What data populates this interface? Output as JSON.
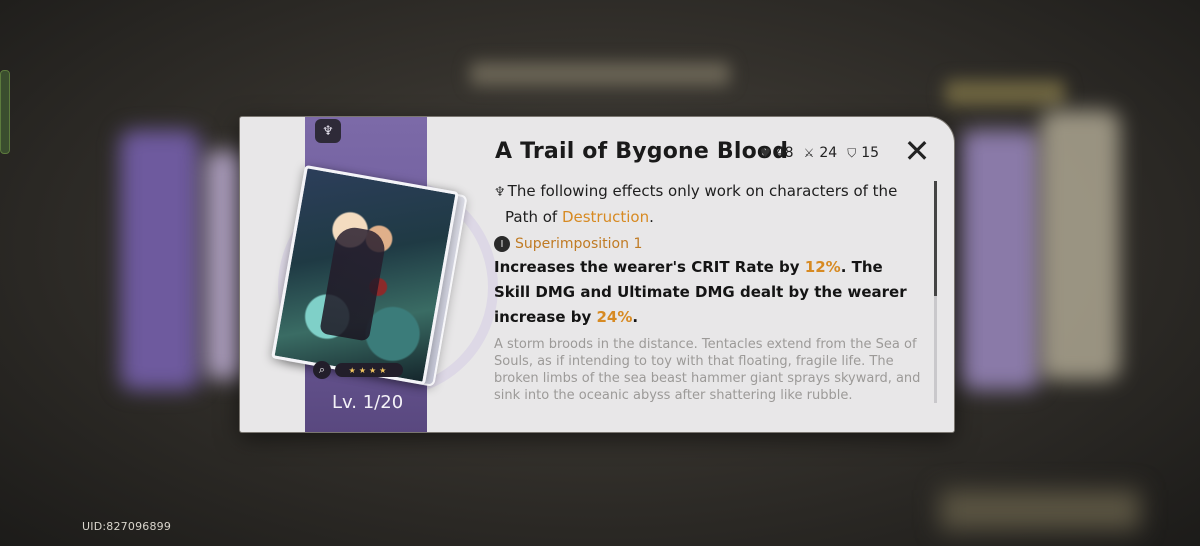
{
  "uid": "UID:827096899",
  "dialog": {
    "title": "A Trail of Bygone Blood",
    "stats": [
      {
        "icon": "heart-icon",
        "value": "48"
      },
      {
        "icon": "sword-icon",
        "value": "24"
      },
      {
        "icon": "shield-icon",
        "value": "15"
      }
    ],
    "level": "Lv. 1/20",
    "stars": "★★★★",
    "path_note": {
      "prefix": "The following effects only work on characters of the",
      "path_intro": "Path of ",
      "path_name": "Destruction",
      "suffix": "."
    },
    "superimposition": {
      "rank_numeral": "I",
      "label": "Superimposition 1"
    },
    "effect": {
      "part1": "Increases the wearer's CRIT Rate by ",
      "crit_rate": "12%",
      "part2": ". The Skill DMG and Ultimate DMG dealt by the wearer increase by ",
      "dmg_bonus": "24%",
      "part3": "."
    },
    "lore": "A storm broods in the distance. Tentacles extend from the Sea of Souls, as if intending to toy with that floating, fragile life. The broken limbs of the sea beast hammer giant sprays skyward, and sink into the oceanic abyss after shattering like rubble."
  },
  "colors": {
    "accent_orange": "#d78a22",
    "ribbon_purple": "#6d5b9a"
  }
}
